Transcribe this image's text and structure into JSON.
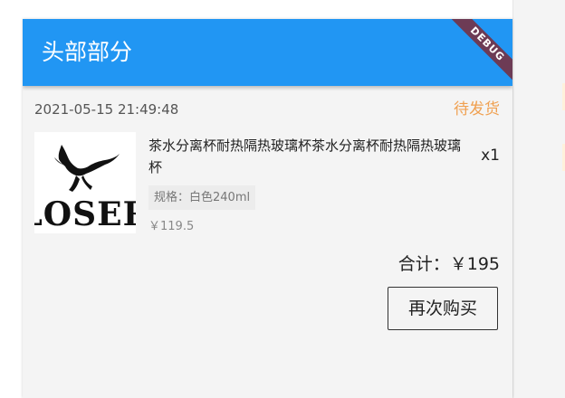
{
  "appbar": {
    "title": "头部部分",
    "debug_banner": "DEBUG"
  },
  "colors": {
    "primary": "#2196f3",
    "status": "#f0a050",
    "debug_ribbon": "#6d3b55"
  },
  "order": {
    "datetime": "2021-05-15 21:49:48",
    "status": "待发货",
    "item": {
      "thumbnail_text": "LOSER",
      "name": "茶水分离杯耐热隔热玻璃杯茶水分离杯耐热隔热玻璃杯",
      "quantity": "x1",
      "spec": "规格：白色240ml",
      "price": "￥119.5"
    },
    "total": "合计：￥195",
    "rebuy_label": "再次购买"
  }
}
